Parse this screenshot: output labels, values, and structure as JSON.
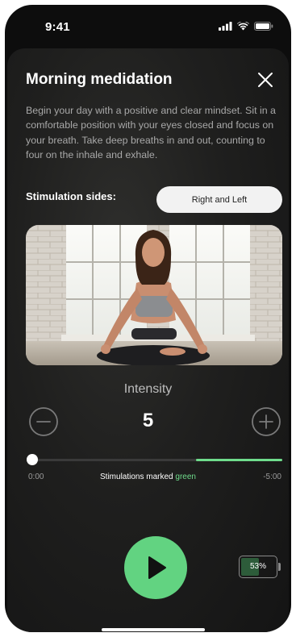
{
  "status_bar": {
    "time": "9:41",
    "icons": [
      "cellular-signal-icon",
      "wifi-icon",
      "battery-icon"
    ]
  },
  "session": {
    "title": "Morning medidation",
    "description": "Begin your day with a positive and clear mindset. Sit in a comfortable position with your eyes closed and focus on your breath. Take deep breaths in and out, counting to four on the inhale and exhale.",
    "stimulation_sides_label": "Stimulation sides:",
    "stimulation_sides_value": "Right and Left"
  },
  "intensity": {
    "label": "Intensity",
    "value": "5"
  },
  "timeline": {
    "start": "0:00",
    "end": "-5:00",
    "legend_prefix": "Stimulations marked",
    "legend_highlight": "green",
    "progress_fraction": 0.0,
    "marked_segment_start_fraction": 0.655,
    "marked_segment_end_fraction": 1.0
  },
  "device_battery": {
    "percent_text": "53%",
    "level_fraction": 0.53
  },
  "colors": {
    "accent_green": "#62d381",
    "marker_green": "#6fdc8c",
    "background": "#0d0d0d",
    "text_primary": "#ffffff",
    "text_secondary": "#a8a8a8"
  },
  "icons": {
    "close": "close-icon",
    "minus": "minus-circle-icon",
    "plus": "plus-circle-icon",
    "play": "play-icon"
  }
}
